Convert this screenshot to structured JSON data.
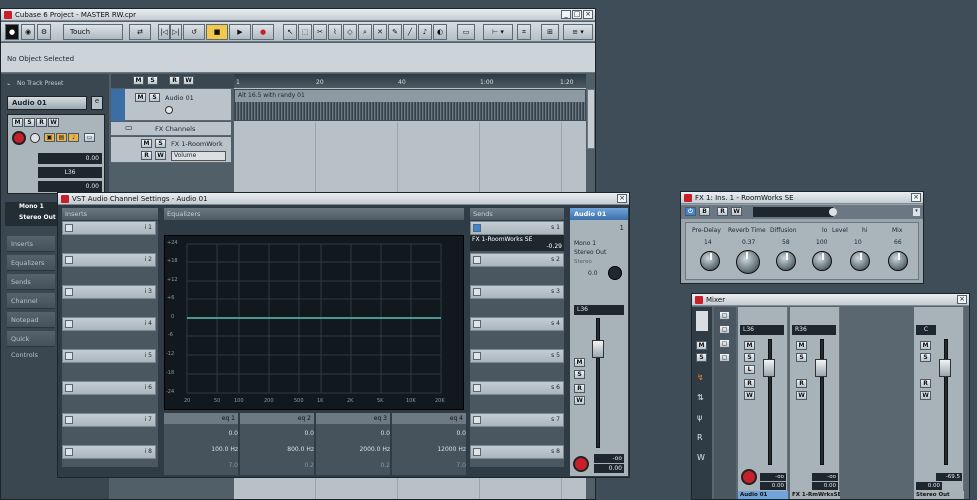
{
  "main_window": {
    "title": "Cubase 6 Project - MASTER RW.cpr",
    "status": "No Object Selected",
    "automation_mode": "Touch",
    "track_preset": "No Track Preset"
  },
  "inspector": {
    "track_name": "Audio 01",
    "volume": "0.00",
    "pan": "L36",
    "pan_value": "0.00",
    "input": "Mono 1",
    "output": "Stereo Out",
    "sections": [
      "Inserts",
      "Equalizers",
      "Sends",
      "Channel",
      "Notepad",
      "Quick Controls"
    ]
  },
  "ruler": {
    "marks": [
      "1",
      "20",
      "40",
      "1:00",
      "1:20"
    ]
  },
  "tracks": [
    {
      "name": "Audio 01",
      "clip": "Alt 16.5 with randy 01"
    },
    {
      "name": "FX Channels"
    },
    {
      "name": "FX 1-RoomWork",
      "param": "Volume"
    }
  ],
  "channel_settings": {
    "title": "VST Audio Channel Settings - Audio 01",
    "inserts_label": "Inserts",
    "equalizers_label": "Equalizers",
    "sends_label": "Sends",
    "insert_slots": [
      "i 1",
      "i 2",
      "i 3",
      "i 4",
      "i 5",
      "i 6",
      "i 7",
      "i 8"
    ],
    "send_slots": [
      "s 1",
      "s 2",
      "s 3",
      "s 4",
      "s 5",
      "s 6",
      "s 7",
      "s 8"
    ],
    "send1_name": "FX 1-RoomWorks SE",
    "send1_level": "-0.29",
    "eq_db_ticks": [
      "+24",
      "+18",
      "+12",
      "+6",
      "0",
      "-6",
      "-12",
      "-18",
      "-24"
    ],
    "eq_freq_ticks": [
      "20",
      "50",
      "100",
      "200",
      "500",
      "1K",
      "2K",
      "5K",
      "10K",
      "20K"
    ],
    "eq_bands": [
      {
        "label": "eq 1",
        "gain": "0.0",
        "freq": "100.0 Hz",
        "q": "7.0"
      },
      {
        "label": "eq 2",
        "gain": "0.0",
        "freq": "800.0 Hz",
        "q": "0.2"
      },
      {
        "label": "eq 3",
        "gain": "0.0",
        "freq": "2000.0 Hz",
        "q": "0.2"
      },
      {
        "label": "eq 4",
        "gain": "0.0",
        "freq": "12000 Hz",
        "q": "7.0"
      }
    ],
    "strip": {
      "name": "Audio 01",
      "number": "1",
      "input": "Mono 1",
      "output": "Stereo Out",
      "mode": "Stereo",
      "pan_value": "0.0",
      "pan": "L36",
      "volume": "0.00",
      "meter": "-oo"
    }
  },
  "fx_window": {
    "title": "FX 1: Ins. 1 - RoomWorks SE",
    "params": [
      {
        "label": "Pre-Delay",
        "value": "14"
      },
      {
        "label": "Reverb Time",
        "value": "0.37"
      },
      {
        "label": "Diffusion",
        "value": "58"
      },
      {
        "label": "lo",
        "value": "100"
      },
      {
        "label": "Level",
        "value": "10"
      },
      {
        "label": "hi",
        "value": ""
      },
      {
        "label": "Mix",
        "value": "66"
      }
    ]
  },
  "mixer": {
    "title": "Mixer",
    "channels": [
      {
        "name": "Audio 01",
        "pan": "L36",
        "volume": "0.00",
        "meter": "-oo"
      },
      {
        "name": "FX 1-RmWrksSE",
        "pan": "R36",
        "volume": "0.00",
        "meter": "-oo"
      },
      {
        "name": "Stereo Out",
        "pan": "C",
        "volume": "0.00",
        "meter": "-69.5"
      }
    ]
  }
}
